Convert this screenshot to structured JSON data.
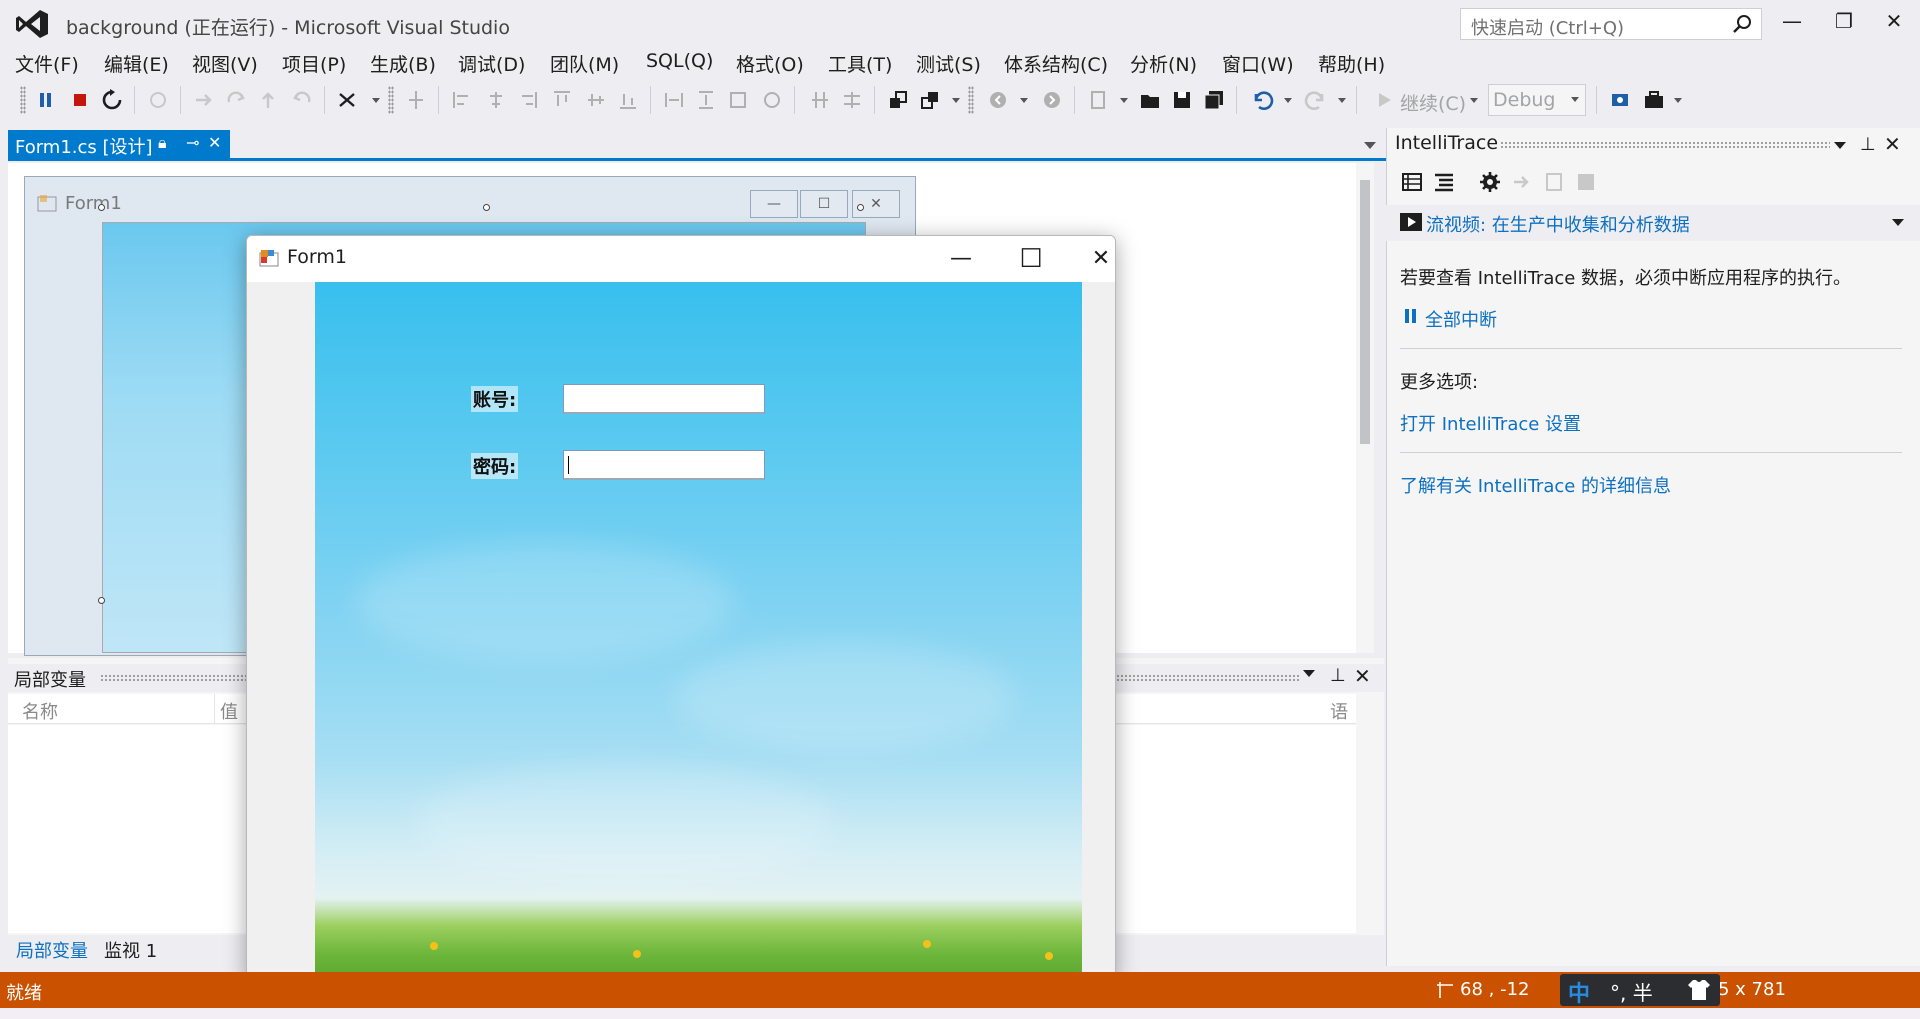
{
  "window": {
    "title": "background (正在运行) - Microsoft Visual Studio",
    "quick_launch_placeholder": "快速启动 (Ctrl+Q)",
    "minimize": "—",
    "restore": "❐",
    "close": "✕"
  },
  "menu": [
    "文件(F)",
    "编辑(E)",
    "视图(V)",
    "项目(P)",
    "生成(B)",
    "调试(D)",
    "团队(M)",
    "SQL(Q)",
    "格式(O)",
    "工具(T)",
    "测试(S)",
    "体系结构(C)",
    "分析(N)",
    "窗口(W)",
    "帮助(H)"
  ],
  "toolbar": {
    "continue_label": "继续(C)",
    "config_value": "Debug"
  },
  "doc_tab": {
    "label": "Form1.cs [设计]",
    "pin": "⊸",
    "close": "✕"
  },
  "designer": {
    "form_title": "Form1"
  },
  "locals": {
    "title": "局部变量",
    "columns": [
      "名称",
      "值",
      "语言"
    ],
    "bottom_tabs": [
      "局部变量",
      "监视 1"
    ]
  },
  "intellitrace": {
    "title": "IntelliTrace",
    "banner": "流视频: 在生产中收集和分析数据",
    "message": "若要查看 IntelliTrace 数据，必须中断应用程序的执行。",
    "break_all": "全部中断",
    "more_options": "更多选项:",
    "open_settings": "打开 IntelliTrace 设置",
    "learn_more": "了解有关 IntelliTrace 的详细信息"
  },
  "running_form": {
    "title": "Form1",
    "account_label": "账号:",
    "password_label": "密码:",
    "account_value": "",
    "password_value": ""
  },
  "statusbar": {
    "text": "就绪",
    "position": "68 , -12",
    "size": "5 x 781",
    "ime": "中",
    "ime_rest": "°, 半"
  },
  "colors": {
    "accent": "#007acc",
    "status_bar": "#ca5100",
    "link": "#0e70c0"
  }
}
